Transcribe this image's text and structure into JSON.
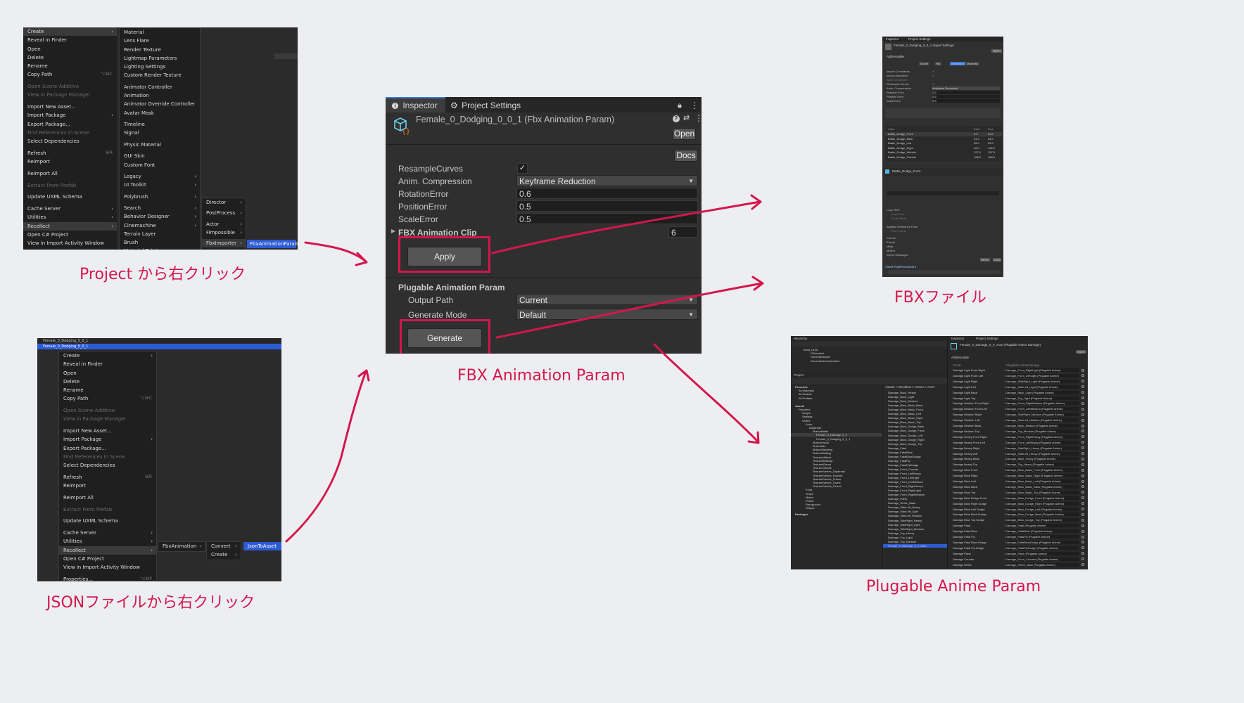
{
  "captions": {
    "project_right_click": "Project から右クリック",
    "json_right_click": "JSONファイルから右クリック",
    "fbx_animation_param": "FBX Animation Param",
    "fbx_file": "FBXファイル",
    "plugable_anime_param": "Plugable Anime Param"
  },
  "project_menu": {
    "main_items": [
      "Create",
      "Reveal in Finder",
      "Open",
      "Delete",
      "Rename",
      "Copy Path",
      "Open Scene Additive",
      "View in Package Manager",
      "Import New Asset...",
      "Import Package",
      "Export Package...",
      "Find References In Scene",
      "Select Dependencies",
      "Refresh",
      "Reimport",
      "Reimport All",
      "Extract From Prefab",
      "Update UXML Schema",
      "Cache Server",
      "Utilities",
      "Recollect",
      "Open C# Project",
      "View in Import Activity Window",
      "Properties..."
    ],
    "shortcuts": {
      "copy_path": "⌥⌘C",
      "refresh": "⌘R",
      "properties": "⌥⌘P"
    },
    "create_items": [
      "Material",
      "Lens Flare",
      "Render Texture",
      "Lightmap Parameters",
      "Lighting Settings",
      "Custom Render Texture",
      "Animator Controller",
      "Animation",
      "Animator Override Controller",
      "Avatar Mask",
      "Timeline",
      "Signal",
      "Physic Material",
      "GUI Skin",
      "Custom Font",
      "Legacy",
      "UI Toolkit",
      "Polybrush",
      "Search",
      "Behavior Designer",
      "Cinemachine",
      "Terrain Layer",
      "Brush",
      "Material Palette",
      "Recollect"
    ],
    "recollect_items": [
      "Director",
      "PostProcess",
      "Actor",
      "Fimpossible",
      "FbxImporter"
    ],
    "fbx_item": "FbxAnimationParam"
  },
  "json_menu": {
    "tree_items": [
      "Female_0_Dodging_0_0_1",
      "Female_0_Dodging_0_0_1"
    ],
    "main_items": [
      "Create",
      "Reveal in Finder",
      "Open",
      "Delete",
      "Rename",
      "Copy Path",
      "Open Scene Additive",
      "View in Package Manager",
      "Import New Asset...",
      "Import Package",
      "Export Package...",
      "Find References In Scene",
      "Select Dependencies",
      "Refresh",
      "Reimport",
      "Reimport All",
      "Extract From Prefab",
      "Update UXML Schema",
      "Cache Server",
      "Utilities",
      "Recollect",
      "Open C# Project",
      "View in Import Activity Window",
      "Properties..."
    ],
    "shortcuts": {
      "copy_path": "⌥⌘C",
      "refresh": "⌘R",
      "properties": "⌥⌘P"
    },
    "sub1": "FbxAnimation",
    "sub2": [
      "Convert",
      "Create"
    ],
    "sub3": "JsonToAsset"
  },
  "inspector": {
    "tab_inspector": "Inspector",
    "tab_project_settings": "Project Settings",
    "asset_title": "Female_0_Dodging_0_0_1 (Fbx Animation Param)",
    "open_button": "Open",
    "docs_button": "Docs",
    "fields": {
      "resample_curves": "ResampleCurves",
      "anim_compression": "Anim. Compression",
      "anim_compression_value": "Keyframe Reduction",
      "rotation_error": "RotationError",
      "rotation_error_value": "0.6",
      "position_error": "PositionError",
      "position_error_value": "0.5",
      "scale_error": "ScaleError",
      "scale_error_value": "0.5",
      "fbx_animation_clip": "FBX Animation Clip",
      "fbx_animation_clip_count": "6"
    },
    "apply_button": "Apply",
    "section_title": "Plugable Animation Param",
    "output_path": "Output Path",
    "output_path_value": "Current",
    "generate_mode": "Generate Mode",
    "generate_mode_value": "Default",
    "generate_button": "Generate"
  },
  "fbx_panel": {
    "tabs": [
      "Inspector",
      "Project Settings"
    ],
    "title": "Female_0_Dodging_0_0_1 Import Settings",
    "open": "Open",
    "addressable": "Addressable",
    "subtabs": [
      "Model",
      "Rig",
      "Animation",
      "Materials"
    ],
    "rows": [
      "Import Constraints",
      "Import Animation",
      "Bake Animations",
      "Resample Curves",
      "Anim. Compression",
      "Rotation Error",
      "Position Error",
      "Scale Error"
    ],
    "compression_value": "Keyframe Reduction",
    "values": [
      "0.6",
      "0.5",
      "0.5"
    ],
    "clips_header": [
      "Clips",
      "Start",
      "End"
    ],
    "clips": [
      {
        "name": "Battle_Dodge_Front",
        "start": "0.0",
        "end": "33.0"
      },
      {
        "name": "Battle_Dodge_Back",
        "start": "34.0",
        "end": "64.0"
      },
      {
        "name": "Battle_Dodge_Left",
        "start": "65.0",
        "end": "95.0"
      },
      {
        "name": "Battle_Dodge_Right",
        "start": "96.0",
        "end": "126.0"
      },
      {
        "name": "Battle_Dodge_Wobble",
        "start": "127.0",
        "end": "157.0"
      },
      {
        "name": "Battle_Dodge_Twinkle",
        "start": "158.0",
        "end": "188.0"
      }
    ],
    "clip_name": "Battle_Dodge_Front",
    "lower_rows": [
      "Loop Time",
      "Loop Pose",
      "Cycle Offset",
      "Additive Reference Pose",
      "Pose Frame",
      "Curves",
      "Events",
      "Mask",
      "Motion",
      "Import Messages"
    ],
    "buttons": [
      "Revert",
      "Apply"
    ],
    "footer": "Asset PostProcessors"
  },
  "plugable_panel": {
    "hierarchy_tab": "Hierarchy",
    "inspector_tab": "Inspector",
    "project_settings_tab": "Project Settings",
    "hier_items": [
      "Build_0105",
      "DRecollect",
      "GeneratedActor",
      "GeneratedConstruction"
    ],
    "project_tab": "Project",
    "title": "Female_0_Damage_0_0_Auto (Plugable Anime Damage)",
    "open": "Open",
    "addressable": "Addressable",
    "tree": [
      "Favorites",
      "All Materials",
      "All Models",
      "All Prefabs",
      "Assets",
      "Recollect",
      "Scripts",
      "Settings",
      "Vertex",
      "Actor",
      "Daybreak",
      "MotionBattle",
      "Female_0_Damage_0_0",
      "Female_0_Dodging_0_0_1",
      "MotionFacial",
      "MotionIdle",
      "MotionStanding",
      "MotionWalking",
      "TexturedAttack",
      "TexturedMatcap",
      "TexturedRamp",
      "TexturedShade",
      "TexturedVertex_Daybreak",
      "TexturedVertex_Explore",
      "TexturedVertex_Frame",
      "TexturedVertex_Guest",
      "TexturedVertex_Period",
      "Extra",
      "Graph",
      "Melon",
      "Peach",
      "Background",
      "Unique",
      "Packages"
    ],
    "breadcrumb": "Assets > Recollect > Vertex > Actor",
    "files": [
      "Damage_Back_Heavy",
      "Damage_Back_Light",
      "Damage_Back_Medium",
      "Damage_Blow_Basic_Back",
      "Damage_Blow_Basic_Front",
      "Damage_Blow_Basic_Left",
      "Damage_Blow_Basic_Right",
      "Damage_Blow_Basic_Top",
      "Damage_Blow_Dodge_Back",
      "Damage_Blow_Dodge_Front",
      "Damage_Blow_Dodge_Left",
      "Damage_Blow_Dodge_Right",
      "Damage_Blow_Dodge_Top",
      "Damage_Fatal",
      "Damage_FatalBlow",
      "Damage_FatalBlowDodge",
      "Damage_FatalFly",
      "Damage_FatalFlyDodge",
      "Damage_Front_Counter",
      "Damage_Front_LeftHeavy",
      "Damage_Front_LeftLight",
      "Damage_Front_LeftMedium",
      "Damage_Front_RightHeavy",
      "Damage_Front_RightLight",
      "Damage_Front_RightMedium",
      "Damage_Panic",
      "Damage_Retire_Base",
      "Damage_SideLeft_Heavy",
      "Damage_SideLeft_Light",
      "Damage_SideLeft_Medium",
      "Damage_SideRight_Heavy",
      "Damage_SideRight_Light",
      "Damage_SideRight_Medium",
      "Damage_Top_Heavy",
      "Damage_Top_Light",
      "Damage_Top_Medium",
      "Female_0_Damage_0_0_Auto"
    ],
    "script_label": "Script",
    "script_value": "PlugableAnimeDamage",
    "entries": [
      {
        "k": "Damage Light Front Right",
        "v": "Damage_Front_RightLight (Plugable Anime)"
      },
      {
        "k": "Damage Light Front Left",
        "v": "Damage_Front_LeftLight (Plugable Anime)"
      },
      {
        "k": "Damage Light Right",
        "v": "Damage_SideRight_Light (Plugable Anime)"
      },
      {
        "k": "Damage Light Left",
        "v": "Damage_SideLeft_Light (Plugable Anime)"
      },
      {
        "k": "Damage Light Back",
        "v": "Damage_Back_Light (Plugable Anime)"
      },
      {
        "k": "Damage Light Top",
        "v": "Damage_Top_Light (Plugable Anime)"
      },
      {
        "k": "Damage Medium Front Right",
        "v": "Damage_Front_RightMedium (Plugable Anime)"
      },
      {
        "k": "Damage Medium Front Left",
        "v": "Damage_Front_LeftMedium (Plugable Anime)"
      },
      {
        "k": "Damage Medium Right",
        "v": "Damage_SideRight_Medium (Plugable Anime)"
      },
      {
        "k": "Damage Medium Left",
        "v": "Damage_SideLeft_Medium (Plugable Anime)"
      },
      {
        "k": "Damage Medium Back",
        "v": "Damage_Back_Medium (Plugable Anime)"
      },
      {
        "k": "Damage Medium Top",
        "v": "Damage_Top_Medium (Plugable Anime)"
      },
      {
        "k": "Damage Heavy Front Right",
        "v": "Damage_Front_RightHeavy (Plugable Anime)"
      },
      {
        "k": "Damage Heavy Front Left",
        "v": "Damage_Front_LeftHeavy (Plugable Anime)"
      },
      {
        "k": "Damage Heavy Right",
        "v": "Damage_SideRight_Heavy (Plugable Anime)"
      },
      {
        "k": "Damage Heavy Left",
        "v": "Damage_SideLeft_Heavy (Plugable Anime)"
      },
      {
        "k": "Damage Heavy Back",
        "v": "Damage_Back_Heavy (Plugable Anime)"
      },
      {
        "k": "Damage Heavy Top",
        "v": "Damage_Top_Heavy (Plugable Anime)"
      },
      {
        "k": "Damage Blow Front",
        "v": "Damage_Blow_Basic_Front (Plugable Anime)"
      },
      {
        "k": "Damage Blow Right",
        "v": "Damage_Blow_Basic_Right (Plugable Anime)"
      },
      {
        "k": "Damage Blow Left",
        "v": "Damage_Blow_Basic_Left (Plugable Anime)"
      },
      {
        "k": "Damage Blow Back",
        "v": "Damage_Blow_Basic_Back (Plugable Anime)"
      },
      {
        "k": "Damage Blow Top",
        "v": "Damage_Blow_Basic_Top (Plugable Anime)"
      },
      {
        "k": "Damage Blow Dodge Front",
        "v": "Damage_Blow_Dodge_Front (Plugable Anime)"
      },
      {
        "k": "Damage Blow Right Dodge",
        "v": "Damage_Blow_Dodge_Right (Plugable Anime)"
      },
      {
        "k": "Damage Blow Left Dodge",
        "v": "Damage_Blow_Dodge_Left (Plugable Anime)"
      },
      {
        "k": "Damage Blow Back Dodge",
        "v": "Damage_Blow_Dodge_Back (Plugable Anime)"
      },
      {
        "k": "Damage Blow Top Dodge",
        "v": "Damage_Blow_Dodge_Top (Plugable Anime)"
      },
      {
        "k": "Damage Fatal",
        "v": "Damage_Fatal (Plugable Anime)"
      },
      {
        "k": "Damage Fatal Blow",
        "v": "Damage_FatalBlow (Plugable Anime)"
      },
      {
        "k": "Damage Fatal Fly",
        "v": "Damage_FatalFly (Plugable Anime)"
      },
      {
        "k": "Damage Fatal Blow Dodge",
        "v": "Damage_FatalBlowDodge (Plugable Anime)"
      },
      {
        "k": "Damage Fatal Fly Dodge",
        "v": "Damage_FatalFlyDodge (Plugable Anime)"
      },
      {
        "k": "Damage Panic",
        "v": "Damage_Panic (Plugable Anime)"
      },
      {
        "k": "Damage Counter",
        "v": "Damage_Front_Counter (Plugable Anime)"
      },
      {
        "k": "Damage Retire",
        "v": "Damage_Retire_Base (Plugable Anime)"
      }
    ]
  },
  "colors": {
    "accent": "#d3174d",
    "panel_bg": "#2f2f2f",
    "selection_blue": "#2d5bd4"
  }
}
